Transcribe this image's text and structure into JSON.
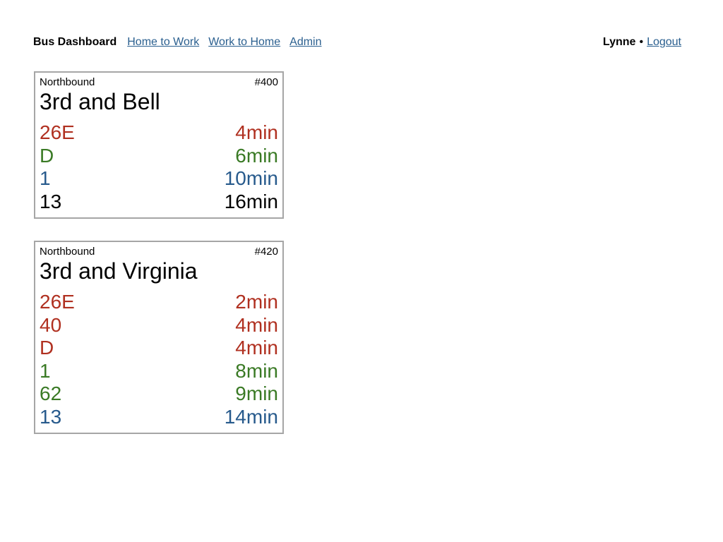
{
  "header": {
    "brand": "Bus Dashboard",
    "nav": [
      {
        "label": "Home to Work"
      },
      {
        "label": "Work to Home"
      },
      {
        "label": "Admin"
      }
    ],
    "user": {
      "name": "Lynne",
      "separator": "•",
      "logout": "Logout"
    }
  },
  "colors": {
    "red": "#b03020",
    "green": "#3a7a25",
    "blue": "#275a8c",
    "black": "#000000",
    "link": "#2a5f8f"
  },
  "stops": [
    {
      "direction": "Northbound",
      "number": "#400",
      "name": "3rd and Bell",
      "arrivals": [
        {
          "route": "26E",
          "eta": "4min",
          "status": "red"
        },
        {
          "route": "D",
          "eta": "6min",
          "status": "green"
        },
        {
          "route": "1",
          "eta": "10min",
          "status": "blue"
        },
        {
          "route": "13",
          "eta": "16min",
          "status": "black"
        }
      ]
    },
    {
      "direction": "Northbound",
      "number": "#420",
      "name": "3rd and Virginia",
      "arrivals": [
        {
          "route": "26E",
          "eta": "2min",
          "status": "red"
        },
        {
          "route": "40",
          "eta": "4min",
          "status": "red"
        },
        {
          "route": "D",
          "eta": "4min",
          "status": "red"
        },
        {
          "route": "1",
          "eta": "8min",
          "status": "green"
        },
        {
          "route": "62",
          "eta": "9min",
          "status": "green"
        },
        {
          "route": "13",
          "eta": "14min",
          "status": "blue"
        }
      ]
    }
  ]
}
